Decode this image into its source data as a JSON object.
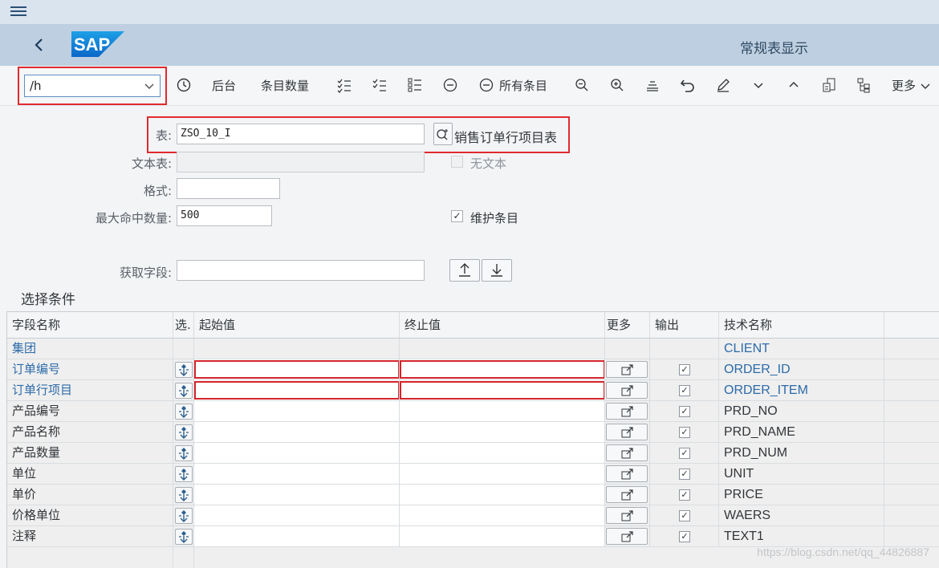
{
  "app": {
    "title": "常规表显示",
    "logo_text": "SAP"
  },
  "toolbar": {
    "command_value": "/h",
    "background_label": "后台",
    "entry_count_label": "条目数量",
    "all_entries_label": "所有条目",
    "more_label": "更多"
  },
  "form": {
    "table_label": "表:",
    "table_value": "ZSO_10_I",
    "table_description": "销售订单行项目表",
    "text_table_label": "文本表:",
    "text_table_value": "",
    "no_text_label": "无文本",
    "no_text_checked": false,
    "layout_label": "格式:",
    "layout_value": "",
    "max_hits_label": "最大命中数量:",
    "max_hits_value": "500",
    "maintain_entries_label": "维护条目",
    "maintain_entries_checked": true,
    "get_fields_label": "获取字段:",
    "get_fields_value": ""
  },
  "selection": {
    "section_title": "选择条件",
    "headers": {
      "field_name": "字段名称",
      "select": "选.",
      "from_value": "起始值",
      "to_value": "终止值",
      "more": "更多",
      "output": "输出",
      "tech_name": "技术名称"
    },
    "rows": [
      {
        "field": "集团",
        "tech": "CLIENT",
        "key": true,
        "editable": false,
        "output": false
      },
      {
        "field": "订单编号",
        "tech": "ORDER_ID",
        "key": true,
        "editable": true,
        "output": true
      },
      {
        "field": "订单行项目",
        "tech": "ORDER_ITEM",
        "key": true,
        "editable": true,
        "output": true
      },
      {
        "field": "产品编号",
        "tech": "PRD_NO",
        "key": false,
        "editable": true,
        "output": true
      },
      {
        "field": "产品名称",
        "tech": "PRD_NAME",
        "key": false,
        "editable": true,
        "output": true
      },
      {
        "field": "产品数量",
        "tech": "PRD_NUM",
        "key": false,
        "editable": true,
        "output": true
      },
      {
        "field": "单位",
        "tech": "UNIT",
        "key": false,
        "editable": true,
        "output": true
      },
      {
        "field": "单价",
        "tech": "PRICE",
        "key": false,
        "editable": true,
        "output": true
      },
      {
        "field": "价格单位",
        "tech": "WAERS",
        "key": false,
        "editable": true,
        "output": true
      },
      {
        "field": "注释",
        "tech": "TEXT1",
        "key": false,
        "editable": true,
        "output": true
      }
    ]
  },
  "watermark": "https://blog.csdn.net/qq_44826887",
  "colors": {
    "title_bar": "#bdcfe0",
    "highlight_red": "#e02a30",
    "link_blue": "#2c6ba9"
  }
}
